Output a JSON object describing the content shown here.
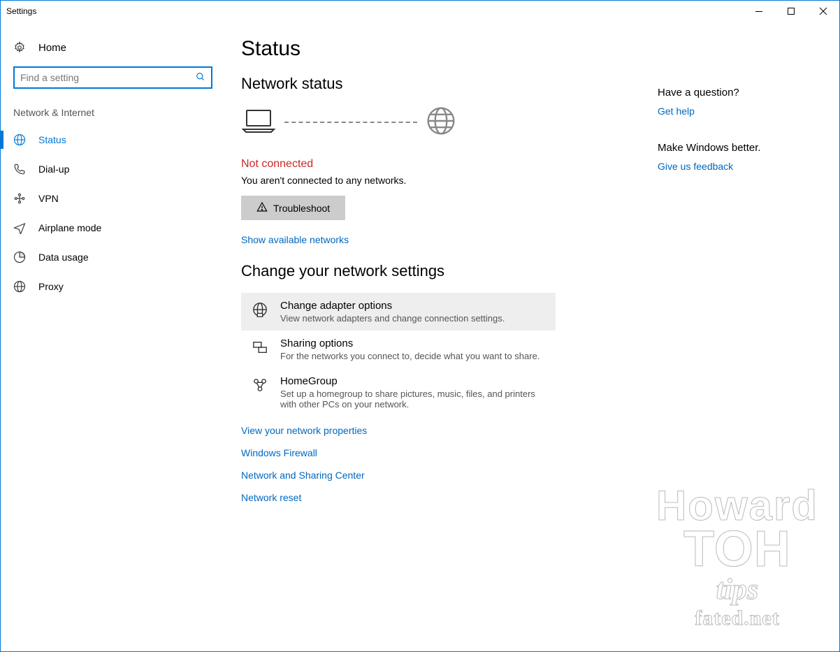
{
  "window": {
    "title": "Settings"
  },
  "sidebar": {
    "home": "Home",
    "search_placeholder": "Find a setting",
    "section": "Network & Internet",
    "items": [
      {
        "label": "Status"
      },
      {
        "label": "Dial-up"
      },
      {
        "label": "VPN"
      },
      {
        "label": "Airplane mode"
      },
      {
        "label": "Data usage"
      },
      {
        "label": "Proxy"
      }
    ]
  },
  "page": {
    "title": "Status",
    "section1": "Network status",
    "status_title": "Not connected",
    "status_desc": "You aren't connected to any networks.",
    "troubleshoot": "Troubleshoot",
    "show_avail": "Show available networks",
    "section2": "Change your network settings",
    "options": [
      {
        "title": "Change adapter options",
        "desc": "View network adapters and change connection settings."
      },
      {
        "title": "Sharing options",
        "desc": "For the networks you connect to, decide what you want to share."
      },
      {
        "title": "HomeGroup",
        "desc": "Set up a homegroup to share pictures, music, files, and printers with other PCs on your network."
      }
    ],
    "links": [
      "View your network properties",
      "Windows Firewall",
      "Network and Sharing Center",
      "Network reset"
    ]
  },
  "aside": {
    "q1": "Have a question?",
    "l1": "Get help",
    "q2": "Make Windows better.",
    "l2": "Give us feedback"
  },
  "watermark": {
    "line1": "Howard",
    "line2": "TOH",
    "line3": "tips",
    "line4": "fated.net"
  }
}
